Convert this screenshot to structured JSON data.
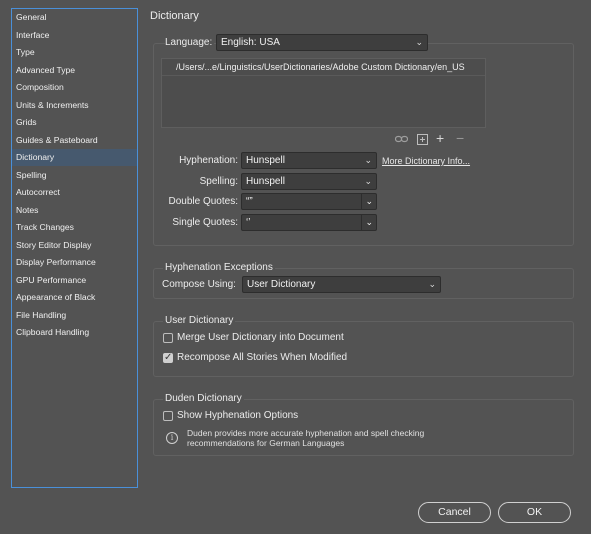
{
  "sidebar": {
    "items": [
      {
        "label": "General"
      },
      {
        "label": "Interface"
      },
      {
        "label": "Type"
      },
      {
        "label": "Advanced Type"
      },
      {
        "label": "Composition"
      },
      {
        "label": "Units & Increments"
      },
      {
        "label": "Grids"
      },
      {
        "label": "Guides & Pasteboard"
      },
      {
        "label": "Dictionary",
        "selected": true
      },
      {
        "label": "Spelling"
      },
      {
        "label": "Autocorrect"
      },
      {
        "label": "Notes"
      },
      {
        "label": "Track Changes"
      },
      {
        "label": "Story Editor Display"
      },
      {
        "label": "Display Performance"
      },
      {
        "label": "GPU Performance"
      },
      {
        "label": "Appearance of Black"
      },
      {
        "label": "File Handling"
      },
      {
        "label": "Clipboard Handling"
      }
    ]
  },
  "page": {
    "title": "Dictionary"
  },
  "dictionary": {
    "language_label": "Language:",
    "language_value": "English: USA",
    "dictionary_paths": [
      "/Users/...e/Linguistics/UserDictionaries/Adobe Custom Dictionary/en_US"
    ],
    "hyphenation_label": "Hyphenation:",
    "hyphenation_value": "Hunspell",
    "more_info_link": "More Dictionary Info...",
    "spelling_label": "Spelling:",
    "spelling_value": "Hunspell",
    "double_quotes_label": "Double Quotes:",
    "double_quotes_value": "“”",
    "single_quotes_label": "Single Quotes:",
    "single_quotes_value": "‘’",
    "icons": [
      "link-icon",
      "new-dictionary-icon",
      "plus-icon",
      "minus-icon"
    ]
  },
  "hyphenation_exceptions": {
    "title": "Hyphenation Exceptions",
    "compose_label": "Compose Using:",
    "compose_value": "User Dictionary"
  },
  "user_dictionary": {
    "title": "User Dictionary",
    "merge_label": "Merge User Dictionary into Document",
    "merge_checked": false,
    "recompose_label": "Recompose All Stories When Modified",
    "recompose_checked": true
  },
  "duden": {
    "title": "Duden Dictionary",
    "show_options_label": "Show Hyphenation Options",
    "show_options_checked": false,
    "info_text": "Duden provides more accurate hyphenation and spell checking recommendations for German Languages"
  },
  "buttons": {
    "cancel": "Cancel",
    "ok": "OK"
  }
}
